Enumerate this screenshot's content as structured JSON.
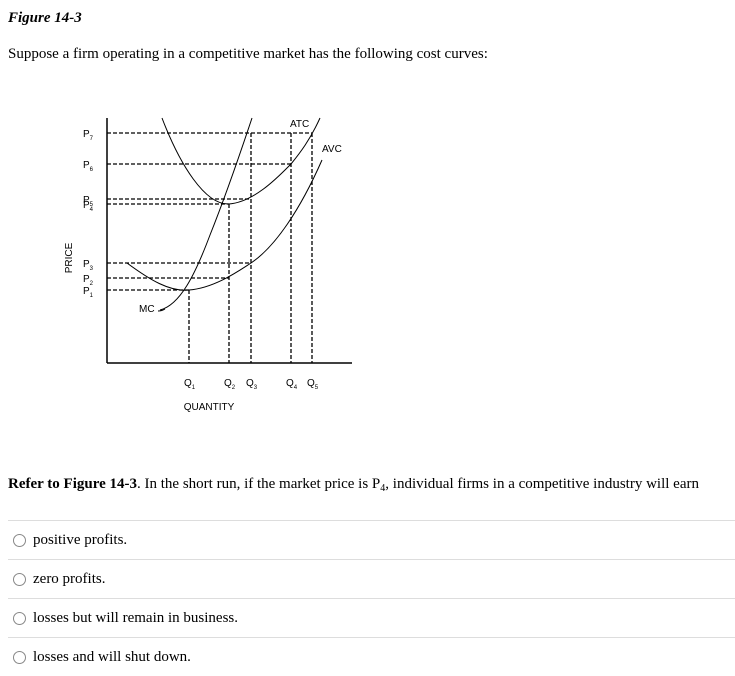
{
  "figure": {
    "title": "Figure 14-3",
    "intro": "Suppose a firm operating in a competitive market has the following cost curves:"
  },
  "chart_data": {
    "type": "line",
    "title": "",
    "xlabel": "QUANTITY",
    "ylabel": "PRICE",
    "price_levels": [
      {
        "label": "P",
        "sub": "1"
      },
      {
        "label": "P",
        "sub": "2"
      },
      {
        "label": "P",
        "sub": "3"
      },
      {
        "label": "P",
        "sub": "4"
      },
      {
        "label": "P",
        "sub": "5"
      },
      {
        "label": "P",
        "sub": "6"
      },
      {
        "label": "P",
        "sub": "7"
      }
    ],
    "quantity_levels": [
      {
        "label": "Q",
        "sub": "1"
      },
      {
        "label": "Q",
        "sub": "2"
      },
      {
        "label": "Q",
        "sub": "3"
      },
      {
        "label": "Q",
        "sub": "4"
      },
      {
        "label": "Q",
        "sub": "5"
      }
    ],
    "curves": [
      {
        "name": "MC",
        "label": "MC"
      },
      {
        "name": "ATC",
        "label": "ATC"
      },
      {
        "name": "AVC",
        "label": "AVC"
      }
    ],
    "intersections": [
      {
        "curve": "AVC",
        "at": [
          "Q1",
          "P1"
        ],
        "note": "MC crosses AVC minimum"
      },
      {
        "curve": "AVC",
        "at": [
          "Q2",
          "P2"
        ]
      },
      {
        "curve": "AVC",
        "at": [
          "Q3",
          "P3"
        ]
      },
      {
        "curve": "ATC",
        "at": [
          "Q2",
          "P4"
        ],
        "note": "MC crosses ATC minimum"
      },
      {
        "curve": "ATC",
        "at": [
          "Q3",
          "P5"
        ]
      },
      {
        "curve": "ATC",
        "at": [
          "Q4",
          "P6"
        ]
      },
      {
        "curve": "ATC",
        "at": [
          "Q5",
          "P7"
        ]
      },
      {
        "curve": "MC",
        "at": [
          "Q3",
          "P7"
        ]
      }
    ]
  },
  "question": {
    "ref": "Refer to Figure 14-3",
    "text_a": ". In the short run, if the market price is P",
    "sub": "4",
    "text_b": ", individual firms in a competitive industry will earn"
  },
  "options": [
    {
      "label": "positive profits."
    },
    {
      "label": "zero profits."
    },
    {
      "label": "losses but will remain in business."
    },
    {
      "label": "losses and will shut down."
    }
  ]
}
